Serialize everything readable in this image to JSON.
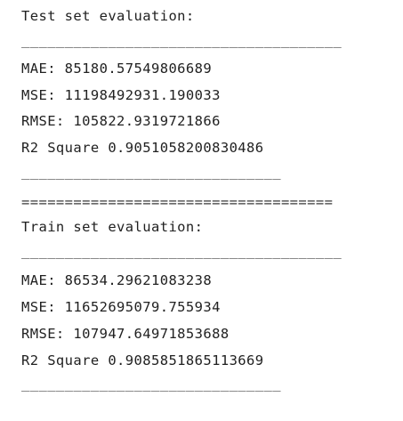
{
  "test": {
    "heading": "Test set evaluation:",
    "separator_top": "_____________________________________",
    "mae": "MAE: 85180.57549806689",
    "mse": "MSE: 11198492931.190033",
    "rmse": "RMSE: 105822.9319721866",
    "r2": "R2 Square 0.9051058200830486",
    "separator_bottom": "______________________________"
  },
  "divider": "====================================",
  "train": {
    "heading": "Train set evaluation:",
    "separator_top": "_____________________________________",
    "mae": "MAE: 86534.29621083238",
    "mse": "MSE: 11652695079.755934",
    "rmse": "RMSE: 107947.64971853688",
    "r2": "R2 Square 0.9085851865113669",
    "separator_bottom": "______________________________"
  }
}
